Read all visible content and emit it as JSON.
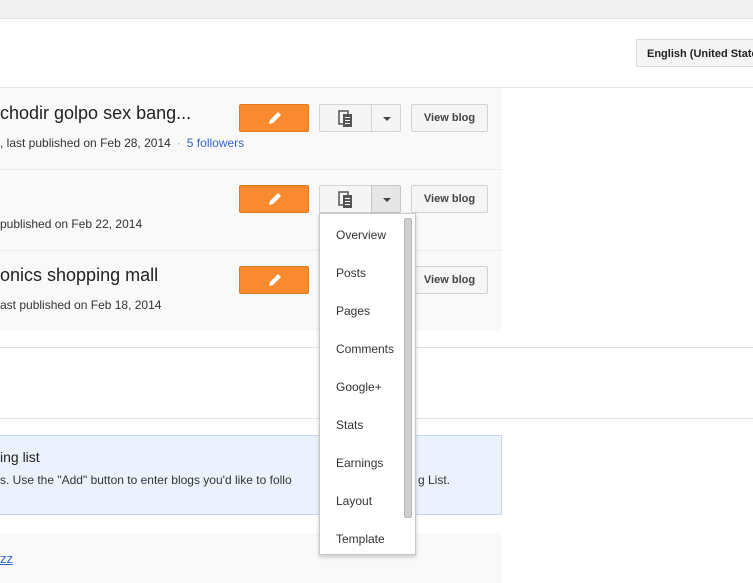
{
  "header": {
    "language_button": "English (United States)"
  },
  "blogs": [
    {
      "title": "chodir golpo sex bang...",
      "meta": ", last published on Feb 28, 2014",
      "followers": "5 followers"
    },
    {
      "title": "",
      "meta": " published on Feb 22, 2014"
    },
    {
      "title": "onics shopping mall",
      "meta": "ast published on Feb 18, 2014"
    }
  ],
  "buttons": {
    "view_blog": "View blog"
  },
  "dropdown_menu": {
    "items": [
      "Overview",
      "Posts",
      "Pages",
      "Comments",
      "Google+",
      "Stats",
      "Earnings",
      "Layout",
      "Template"
    ]
  },
  "reading_list": {
    "title": "ing list",
    "text": "s. Use the \"Add\" button to enter blogs you'd like to follo"
  },
  "reading_list_tail": "g List.",
  "bottom": {
    "link": "zz"
  },
  "icons": {
    "edit": "pencil-icon",
    "posts": "posts-list-icon",
    "caret": "caret-down-icon"
  },
  "colors": {
    "edit_button": "#f98a30",
    "link": "#3366cc",
    "reading_list_bg": "#ebf2fd"
  }
}
